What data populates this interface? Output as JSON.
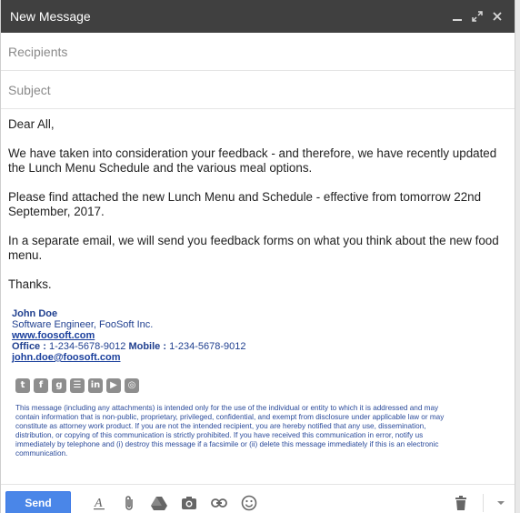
{
  "window": {
    "title": "New Message"
  },
  "fields": {
    "recipients_placeholder": "Recipients",
    "subject_placeholder": "Subject"
  },
  "message": {
    "greeting": "Dear All,",
    "para1": "We have taken into consideration your feedback - and therefore, we have recently updated the Lunch Menu Schedule and the various meal options.",
    "para2": "Please find attached the new Lunch Menu and Schedule - effective from tomorrow 22nd September, 2017.",
    "para3": "In a separate email, we will send you feedback forms on what you think about the new food menu.",
    "closing": "Thanks."
  },
  "signature": {
    "name": "John Doe",
    "title": "Software Engineer, FooSoft Inc.",
    "website": "www.foosoft.com",
    "office_label": "Office :",
    "office_phone": "1-234-5678-9012",
    "mobile_label": "Mobile :",
    "mobile_phone": "1-234-5678-9012",
    "email": "john.doe@foosoft.com",
    "social_icons": [
      "twitter-icon",
      "facebook-icon",
      "google-plus-icon",
      "blogger-icon",
      "linkedin-icon",
      "youtube-icon",
      "instagram-icon"
    ],
    "disclaimer": "This message (including any attachments) is intended only for the use of the individual or entity to which it is addressed and may contain information that is non-public, proprietary, privileged, confidential, and exempt from disclosure under applicable law or may constitute as attorney work product. If you are not the intended recipient, you are hereby notified that any use, dissemination, distribution, or copying of this communication is strictly prohibited. If you have received this communication in error, notify us immediately by telephone and (i) destroy this message if a facsimile or (ii) delete this message immediately if this is an electronic communication."
  },
  "toolbar": {
    "send_label": "Send",
    "tools": [
      "format-text-icon",
      "attach-icon",
      "drive-icon",
      "photo-icon",
      "link-icon",
      "emoji-icon"
    ],
    "right_tools": [
      "trash-icon",
      "more-options-icon"
    ]
  },
  "colors": {
    "titlebar": "#404040",
    "send_button": "#4a86e8",
    "signature_text": "#1f3f8f"
  }
}
